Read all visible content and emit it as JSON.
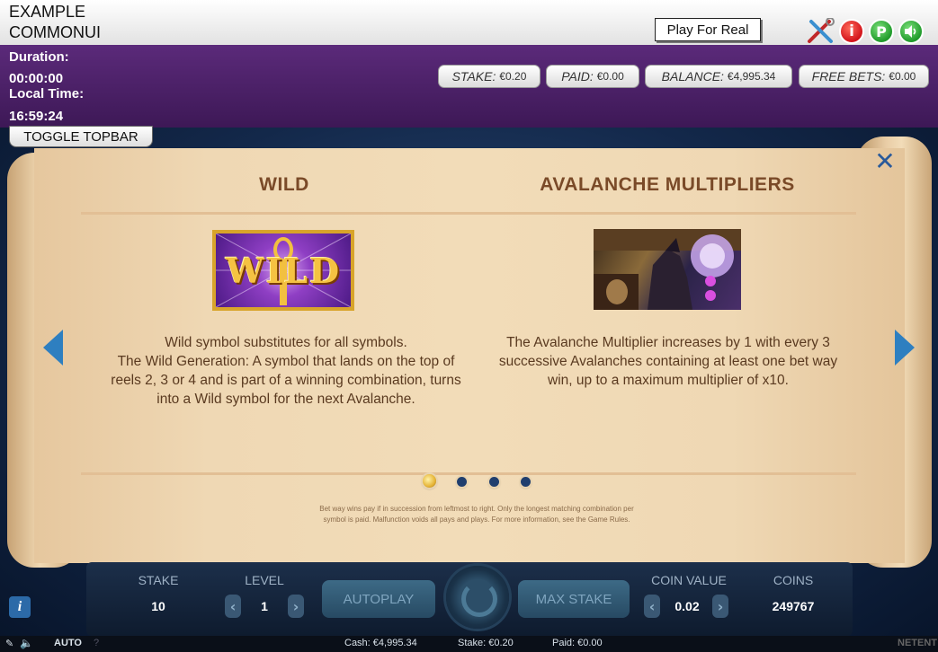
{
  "topbar": {
    "title_line1": "EXAMPLE",
    "title_line2": "COMMONUI",
    "play_for_real": "Play For Real",
    "icons": [
      "tools-icon",
      "info-icon",
      "p-icon",
      "sound-icon"
    ]
  },
  "session": {
    "duration_label": "Duration:",
    "duration_value": "00:00:00",
    "local_time_label": "Local Time:",
    "local_time_value": "16:59:24",
    "toggle_topbar": "TOGGLE TOPBAR"
  },
  "pills": [
    {
      "label": "STAKE:",
      "value": "€0.20"
    },
    {
      "label": "PAID:",
      "value": "€0.00"
    },
    {
      "label": "BALANCE:",
      "value": "€4,995.34"
    },
    {
      "label": "FREE BETS:",
      "value": "€0.00"
    }
  ],
  "paytable": {
    "left": {
      "heading": "WILD",
      "symbol_text": "WILD",
      "lines": [
        "Wild symbol substitutes for all symbols.",
        "The Wild Generation: A symbol that lands on the top of",
        "reels 2, 3 or 4 and is part of a winning combination, turns",
        "into a Wild symbol for the next Avalanche."
      ]
    },
    "right": {
      "heading": "AVALANCHE MULTIPLIERS",
      "lines": [
        "The Avalanche Multiplier increases by 1 with every 3",
        "successive Avalanches containing at least one bet way",
        "win, up to a maximum multiplier of x10."
      ]
    },
    "page_count": 4,
    "current_page": 1,
    "fine_print_1": "Bet way wins pay if in succession from leftmost to right. Only the longest matching combination per",
    "fine_print_2": "symbol is paid. Malfunction voids all pays and plays. For more information, see the Game Rules."
  },
  "controls": {
    "stake_label": "STAKE",
    "stake_value": "10",
    "level_label": "LEVEL",
    "level_value": "1",
    "autoplay": "AUTOPLAY",
    "max_stake": "MAX STAKE",
    "coin_value_label": "COIN VALUE",
    "coin_value": "0.02",
    "coins_label": "COINS",
    "coins_value": "249767",
    "info": "i",
    "chev_left": "‹",
    "chev_right": "›"
  },
  "statusbar": {
    "auto": "AUTO",
    "help": "?",
    "cash": "Cash: €4,995.34",
    "stake": "Stake: €0.20",
    "paid": "Paid: €0.00",
    "brand": "NETENT"
  },
  "colors": {
    "purple": "#4a1f66",
    "parchment": "#efd8b4",
    "heading_brown": "#7a4a28",
    "arrow_blue": "#2e7fc0"
  }
}
